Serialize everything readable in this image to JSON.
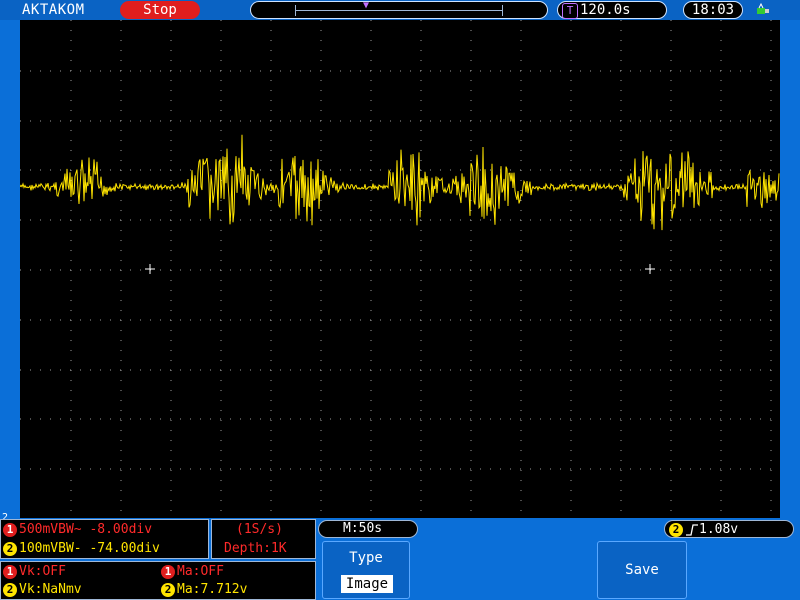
{
  "header": {
    "brand": "AKTAKOM",
    "run_state": "Stop",
    "time_position": "120.0s",
    "clock": "18:03",
    "trigger_time_icon": "T"
  },
  "channel_info": {
    "ch1_line": "500mVBW~ -8.00div",
    "ch2_line": "100mVBW- -74.00div",
    "ch1_badge": "1",
    "ch2_badge": "2"
  },
  "acquisition": {
    "sample_rate": "(1S/s)",
    "depth": "Depth:1K"
  },
  "timebase": {
    "main": "M:50s"
  },
  "trigger": {
    "badge": "2",
    "level": "1.08v",
    "edge_icon": "rising-edge-icon"
  },
  "measurements": {
    "vk1": "Vk:OFF",
    "ma1": "Ma:OFF",
    "vk2": "Vk:NaNmv",
    "ma2": "Ma:7.712v"
  },
  "menu": {
    "type_label": "Type",
    "type_value": "Image",
    "save_label": "Save"
  },
  "colors": {
    "ch1": "#ff2a2a",
    "ch2": "#ffe400",
    "background": "#0b6fd8",
    "screen": "#000000"
  },
  "chart_data": {
    "type": "line",
    "series": [
      {
        "name": "",
        "values": [
          0,
          0,
          0.05,
          0.15,
          0.35,
          0.9,
          0.6,
          0.2,
          0.05,
          0,
          0,
          0,
          0,
          0,
          0.05,
          0.5,
          1.0,
          0.9,
          0.8,
          0.95,
          0.7,
          0.3,
          0.1,
          0.6,
          0.85,
          0.9,
          0.7,
          0.4,
          0.15,
          0,
          0,
          0,
          0,
          0.55,
          0.9,
          0.8,
          0.4,
          0.2,
          0.1,
          0.3,
          0.7,
          0.8,
          0.9,
          0.6,
          0.4,
          0.2,
          0,
          0,
          0,
          0,
          0,
          0,
          0,
          0,
          0.5,
          0.95,
          1.0,
          0.8,
          0.9,
          0.85,
          0.7,
          0.3,
          0,
          0,
          0,
          0.4,
          0.7,
          0.3
        ]
      }
    ]
  }
}
